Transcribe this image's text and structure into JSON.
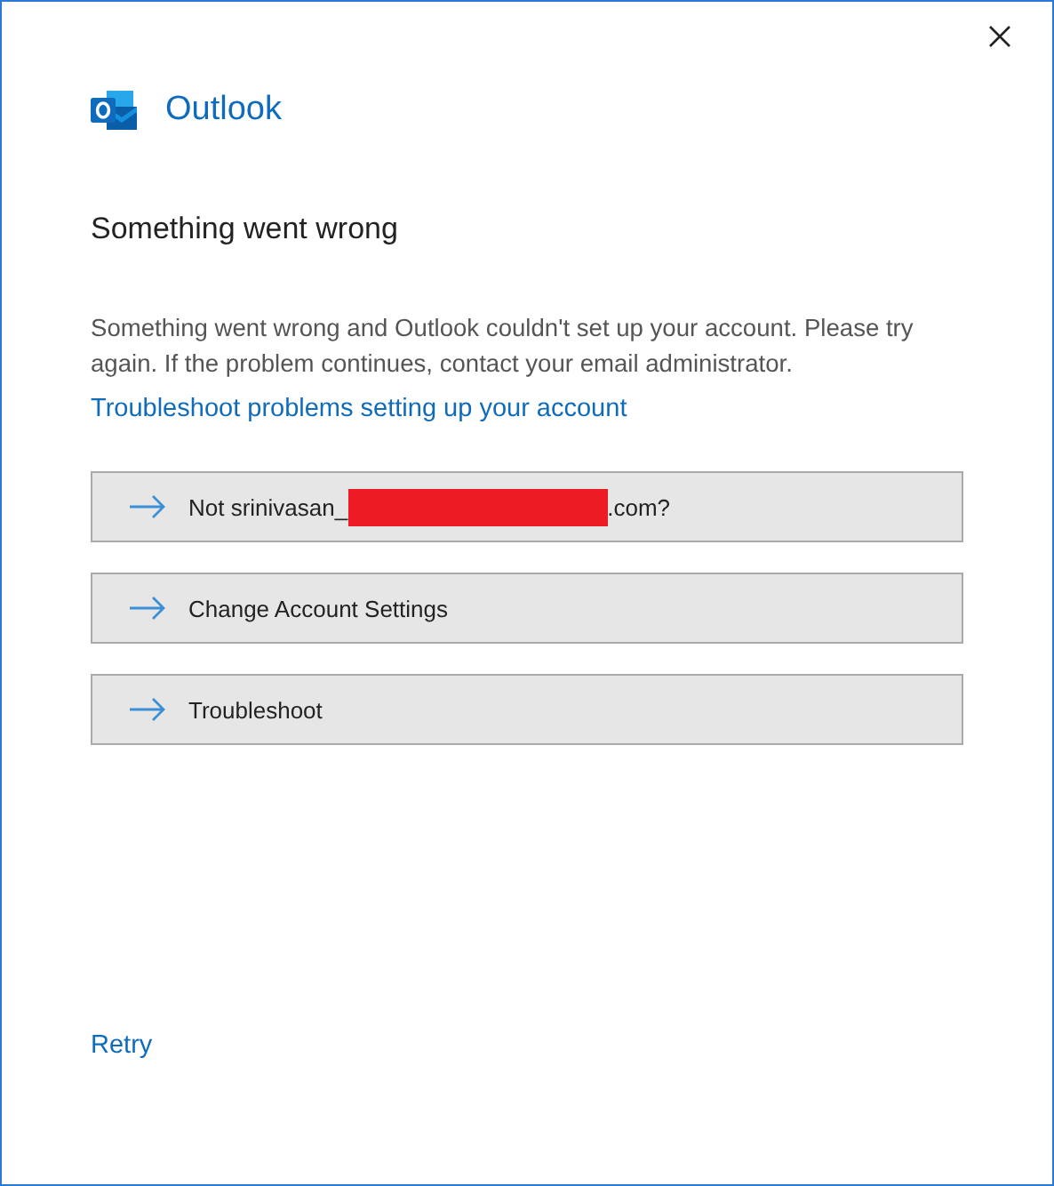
{
  "app": {
    "name": "Outlook"
  },
  "heading": "Something went wrong",
  "message": "Something went wrong and Outlook couldn't set up your account. Please try again. If the problem continues, contact your email administrator.",
  "help_link": "Troubleshoot problems setting up your account",
  "options": [
    {
      "label": "Not srinivasan_",
      "redacted": true,
      "suffix": ".com?"
    },
    {
      "label": "Change Account Settings",
      "redacted": false
    },
    {
      "label": "Troubleshoot",
      "redacted": false
    }
  ],
  "footer_link": "Retry"
}
